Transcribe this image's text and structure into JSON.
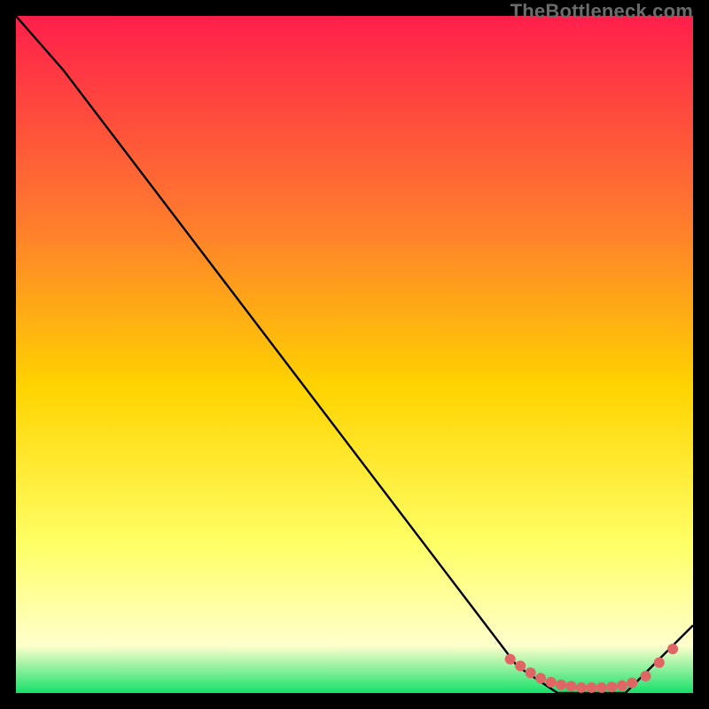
{
  "watermark": "TheBottleneck.com",
  "colors": {
    "gradient_top": "#ff1f4b",
    "gradient_mid1": "#ff7a2e",
    "gradient_mid2": "#ffd400",
    "gradient_mid3": "#ffff66",
    "gradient_mid4": "#ffffcc",
    "gradient_bottom": "#16e06a",
    "curve": "#000000",
    "marker": "#e06666"
  },
  "chart_data": {
    "type": "line",
    "title": "",
    "xlabel": "",
    "ylabel": "",
    "xlim": [
      0,
      100
    ],
    "ylim": [
      0,
      100
    ],
    "series": [
      {
        "name": "bottleneck-curve",
        "x": [
          0,
          7,
          74,
          80,
          90,
          100
        ],
        "y": [
          100,
          92,
          4,
          0,
          0,
          10
        ]
      }
    ],
    "markers": {
      "name": "highlight-points",
      "x": [
        73,
        74.5,
        76,
        77.5,
        79,
        80.5,
        82,
        83.5,
        85,
        86.5,
        88,
        89.5,
        91,
        93,
        95,
        97
      ],
      "y": [
        5,
        4,
        3,
        2.2,
        1.6,
        1.2,
        1,
        0.8,
        0.8,
        0.8,
        0.9,
        1.1,
        1.5,
        2.5,
        4.5,
        6.5
      ]
    }
  }
}
